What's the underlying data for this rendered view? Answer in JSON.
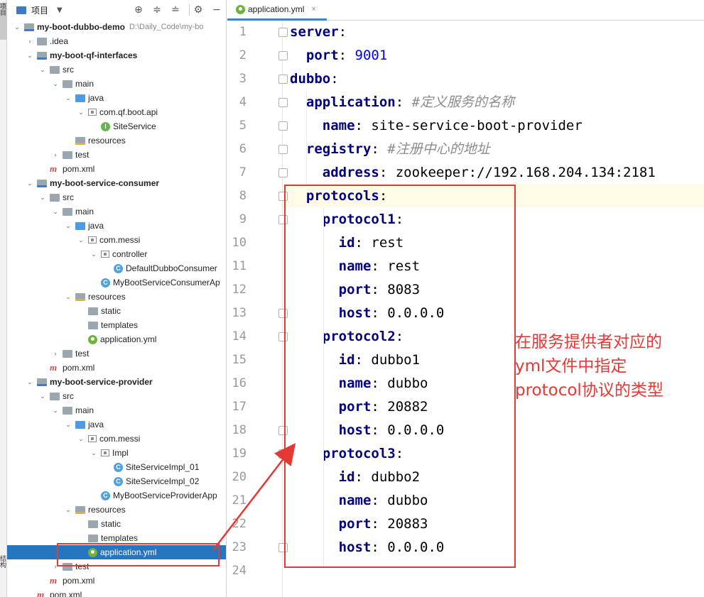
{
  "stripe": {
    "top_label": "项目",
    "bottom_label": "结构"
  },
  "project_panel": {
    "title": "项目",
    "toolbar_icons": [
      "locate-icon",
      "collapse-all-icon",
      "expand-all-icon",
      "settings-icon",
      "hide-icon"
    ],
    "tree": [
      {
        "label": "my-boot-dubbo-demo",
        "path": "D:\\Daily_Code\\my-bo",
        "icon": "module",
        "expanded": true,
        "bold": true
      },
      {
        "label": ".idea",
        "icon": "folder",
        "expanded": false
      },
      {
        "label": "my-boot-qf-interfaces",
        "icon": "module",
        "expanded": true,
        "bold": true
      },
      {
        "label": "src",
        "icon": "folder",
        "expanded": true
      },
      {
        "label": "main",
        "icon": "folder",
        "expanded": true
      },
      {
        "label": "java",
        "icon": "src",
        "expanded": true
      },
      {
        "label": "com.qf.boot.api",
        "icon": "package",
        "expanded": true
      },
      {
        "label": "SiteService",
        "icon": "interface"
      },
      {
        "label": "resources",
        "icon": "resources"
      },
      {
        "label": "test",
        "icon": "folder",
        "expanded": false
      },
      {
        "label": "pom.xml",
        "icon": "maven"
      },
      {
        "label": "my-boot-service-consumer",
        "icon": "module",
        "expanded": true,
        "bold": true
      },
      {
        "label": "src",
        "icon": "folder",
        "expanded": true
      },
      {
        "label": "main",
        "icon": "folder",
        "expanded": true
      },
      {
        "label": "java",
        "icon": "src",
        "expanded": true
      },
      {
        "label": "com.messi",
        "icon": "package",
        "expanded": true
      },
      {
        "label": "controller",
        "icon": "package",
        "expanded": true
      },
      {
        "label": "DefaultDubboConsumer",
        "icon": "class"
      },
      {
        "label": "MyBootServiceConsumerAp",
        "icon": "class"
      },
      {
        "label": "resources",
        "icon": "resources",
        "expanded": true
      },
      {
        "label": "static",
        "icon": "folder"
      },
      {
        "label": "templates",
        "icon": "folder"
      },
      {
        "label": "application.yml",
        "icon": "yml"
      },
      {
        "label": "test",
        "icon": "folder",
        "expanded": false
      },
      {
        "label": "pom.xml",
        "icon": "maven"
      },
      {
        "label": "my-boot-service-provider",
        "icon": "module",
        "expanded": true,
        "bold": true
      },
      {
        "label": "src",
        "icon": "folder",
        "expanded": true
      },
      {
        "label": "main",
        "icon": "folder",
        "expanded": true
      },
      {
        "label": "java",
        "icon": "src",
        "expanded": true
      },
      {
        "label": "com.messi",
        "icon": "package",
        "expanded": true
      },
      {
        "label": "Impl",
        "icon": "package",
        "expanded": true
      },
      {
        "label": "SiteServiceImpl_01",
        "icon": "class"
      },
      {
        "label": "SiteServiceImpl_02",
        "icon": "class"
      },
      {
        "label": "MyBootServiceProviderApp",
        "icon": "class"
      },
      {
        "label": "resources",
        "icon": "resources",
        "expanded": true
      },
      {
        "label": "static",
        "icon": "folder"
      },
      {
        "label": "templates",
        "icon": "folder"
      },
      {
        "label": "application.yml",
        "icon": "yml",
        "selected": true
      },
      {
        "label": "test",
        "icon": "folder",
        "expanded": false
      },
      {
        "label": "pom.xml",
        "icon": "maven"
      },
      {
        "label": "pom.xml",
        "icon": "maven"
      }
    ]
  },
  "editor": {
    "tab": {
      "label": "application.yml",
      "close": "×"
    },
    "lines": [
      [
        {
          "t": "k",
          "s": "server"
        },
        {
          "t": "v",
          "s": ":"
        }
      ],
      [
        {
          "t": "k",
          "s": "  port"
        },
        {
          "t": "v",
          "s": ": "
        },
        {
          "t": "n",
          "s": "9001"
        }
      ],
      [
        {
          "t": "k",
          "s": "dubbo"
        },
        {
          "t": "v",
          "s": ":"
        }
      ],
      [
        {
          "t": "k",
          "s": "  application"
        },
        {
          "t": "v",
          "s": ": "
        },
        {
          "t": "c",
          "s": "#定义服务的名称"
        }
      ],
      [
        {
          "t": "k",
          "s": "    name"
        },
        {
          "t": "v",
          "s": ": site-service-boot-provider"
        }
      ],
      [
        {
          "t": "k",
          "s": "  registry"
        },
        {
          "t": "v",
          "s": ": "
        },
        {
          "t": "c",
          "s": "#注册中心的地址"
        }
      ],
      [
        {
          "t": "k",
          "s": "    address"
        },
        {
          "t": "v",
          "s": ": zookeeper://192.168.204.134:2181"
        }
      ],
      [
        {
          "t": "k",
          "s": "  protocols"
        },
        {
          "t": "v",
          "s": ":"
        }
      ],
      [
        {
          "t": "k",
          "s": "    protocol1"
        },
        {
          "t": "v",
          "s": ":"
        }
      ],
      [
        {
          "t": "k",
          "s": "      id"
        },
        {
          "t": "v",
          "s": ": rest"
        }
      ],
      [
        {
          "t": "k",
          "s": "      name"
        },
        {
          "t": "v",
          "s": ": rest"
        }
      ],
      [
        {
          "t": "k",
          "s": "      port"
        },
        {
          "t": "v",
          "s": ": 8083"
        }
      ],
      [
        {
          "t": "k",
          "s": "      host"
        },
        {
          "t": "v",
          "s": ": 0.0.0.0"
        }
      ],
      [
        {
          "t": "k",
          "s": "    protocol2"
        },
        {
          "t": "v",
          "s": ":"
        }
      ],
      [
        {
          "t": "k",
          "s": "      id"
        },
        {
          "t": "v",
          "s": ": dubbo1"
        }
      ],
      [
        {
          "t": "k",
          "s": "      name"
        },
        {
          "t": "v",
          "s": ": dubbo"
        }
      ],
      [
        {
          "t": "k",
          "s": "      port"
        },
        {
          "t": "v",
          "s": ": 20882"
        }
      ],
      [
        {
          "t": "k",
          "s": "      host"
        },
        {
          "t": "v",
          "s": ": 0.0.0.0"
        }
      ],
      [
        {
          "t": "k",
          "s": "    protocol3"
        },
        {
          "t": "v",
          "s": ":"
        }
      ],
      [
        {
          "t": "k",
          "s": "      id"
        },
        {
          "t": "v",
          "s": ": dubbo2"
        }
      ],
      [
        {
          "t": "k",
          "s": "      name"
        },
        {
          "t": "v",
          "s": ": dubbo"
        }
      ],
      [
        {
          "t": "k",
          "s": "      port"
        },
        {
          "t": "v",
          "s": ": 20883"
        }
      ],
      [
        {
          "t": "k",
          "s": "      host"
        },
        {
          "t": "v",
          "s": ": 0.0.0.0"
        }
      ],
      []
    ],
    "current_line": 8
  },
  "annotation": {
    "lines": [
      "在服务提供者对应的",
      "yml文件中指定",
      "protocol协议的类型"
    ],
    "color": "#e53935"
  }
}
